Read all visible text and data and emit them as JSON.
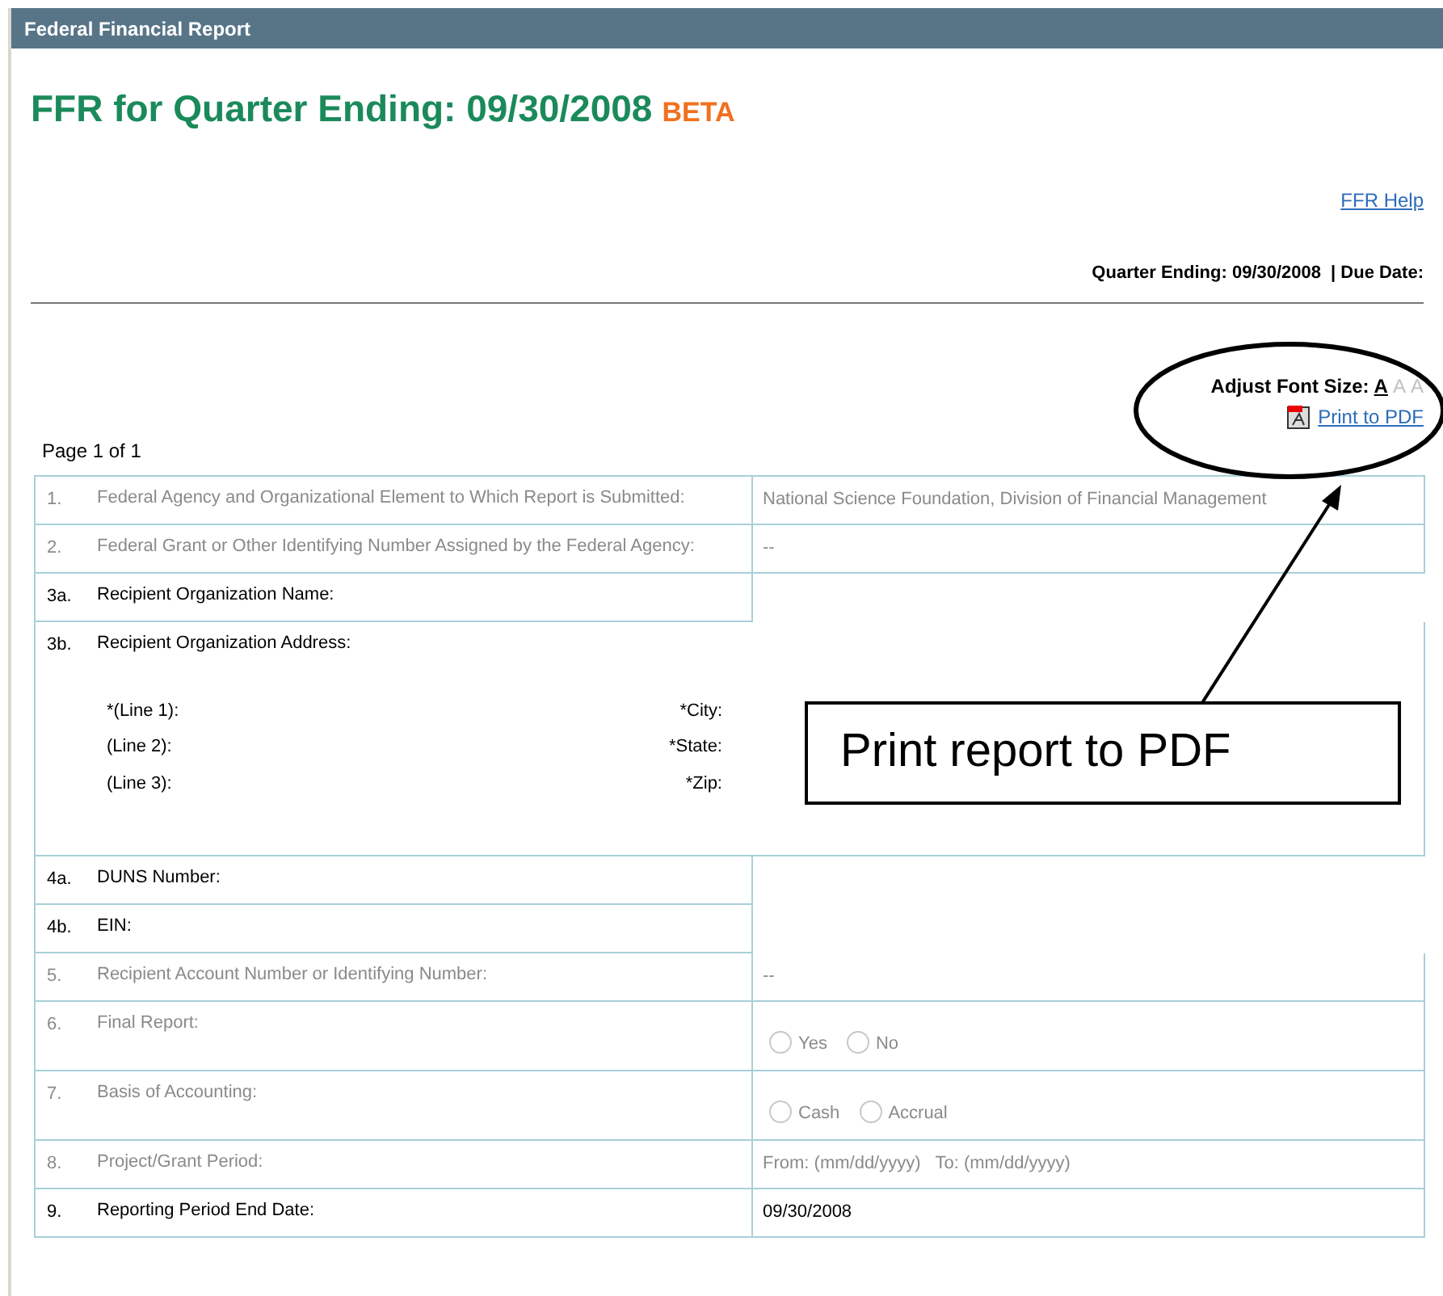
{
  "window": {
    "title": "Federal Financial Report"
  },
  "heading": {
    "title": "FFR for Quarter Ending: 09/30/2008",
    "badge": "BETA"
  },
  "help_link": "FFR Help",
  "quarter_line": {
    "quarter": "Quarter Ending: 09/30/2008",
    "due": "| Due Date:"
  },
  "font_size": {
    "label": "Adjust Font Size:",
    "options": [
      {
        "label": "A",
        "selected": true
      },
      {
        "label": "A",
        "selected": false
      },
      {
        "label": "A",
        "selected": false
      }
    ]
  },
  "print_link": "Print to PDF",
  "page_label": "Page 1 of 1",
  "rows": [
    {
      "kind": "text",
      "number": "1.",
      "label": "Federal Agency and Organizational Element to Which Report is Submitted:",
      "value": "National Science Foundation, Division of Financial Management",
      "disabled": true
    },
    {
      "kind": "text",
      "number": "2.",
      "label": "Federal Grant or Other Identifying Number Assigned by the Federal Agency:",
      "value": "--",
      "disabled": true
    },
    {
      "kind": "label",
      "number": "3a.",
      "label": "Recipient Organization Name:",
      "disabled": false
    },
    {
      "kind": "address",
      "number": "3b.",
      "label": "Recipient Organization Address:",
      "disabled": false,
      "lines": [
        "*(Line 1):",
        "(Line 2):",
        "(Line 3):"
      ],
      "places": [
        "*City:",
        "*State:",
        "*Zip:"
      ]
    },
    {
      "kind": "label",
      "number": "4a.",
      "label": "DUNS Number:",
      "disabled": false
    },
    {
      "kind": "label",
      "number": "4b.",
      "label": "EIN:",
      "disabled": false
    },
    {
      "kind": "text",
      "number": "5.",
      "label": "Recipient Account Number or Identifying Number:",
      "value": "--",
      "disabled": true
    },
    {
      "kind": "radio",
      "number": "6.",
      "label": "Final Report:",
      "disabled": true,
      "options": [
        {
          "label": "Yes",
          "selected": false
        },
        {
          "label": "No",
          "selected": false
        }
      ]
    },
    {
      "kind": "radio",
      "number": "7.",
      "label": "Basis of Accounting:",
      "disabled": true,
      "options": [
        {
          "label": "Cash",
          "selected": false
        },
        {
          "label": "Accrual",
          "selected": false
        }
      ]
    },
    {
      "kind": "text",
      "number": "8.",
      "label": "Project/Grant Period:",
      "value": "From: (mm/dd/yyyy)   To: (mm/dd/yyyy)",
      "disabled": true
    },
    {
      "kind": "text",
      "number": "9.",
      "label": "Reporting Period End Date:",
      "value": "09/30/2008",
      "disabled": false
    }
  ],
  "callout": {
    "text": "Print report to PDF"
  }
}
